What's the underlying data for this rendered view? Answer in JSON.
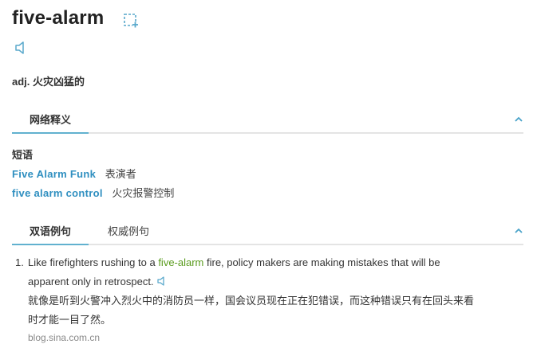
{
  "entry": {
    "word": "five-alarm",
    "wordbook_icon": "add-to-wordbook-icon",
    "pron_icon": "speaker-icon",
    "definition": "adj. 火灾凶猛的"
  },
  "colors": {
    "link": "#2f8fc0",
    "tab_underline": "#61b1cf",
    "highlight": "#5a9b1e"
  },
  "web_section": {
    "tabs": [
      {
        "label": "网络释义"
      }
    ],
    "phrase_title": "短语",
    "phrases": [
      {
        "en": "Five Alarm Funk",
        "cn": "表演者"
      },
      {
        "en": "five alarm control",
        "cn": "火灾报警控制"
      }
    ]
  },
  "examples_section": {
    "tabs": [
      {
        "label": "双语例句"
      },
      {
        "label": "权威例句"
      }
    ],
    "examples": [
      {
        "num": "1.",
        "en_before": "Like firefighters rushing to a ",
        "en_highlight": "five-alarm",
        "en_after_line1": " fire, policy makers are making mistakes that will be",
        "en_line2": "apparent only in retrospect.",
        "cn_line1": "就像是听到火警冲入烈火中的消防员一样，国会议员现在正在犯错误，而这种错误只有在回头来看",
        "cn_line2": "时才能一目了然。",
        "source": "blog.sina.com.cn"
      }
    ]
  }
}
